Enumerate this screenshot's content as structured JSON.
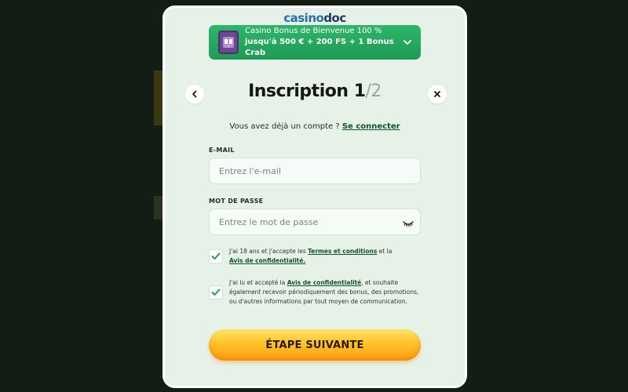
{
  "header": {
    "logo_main": "casino",
    "logo_accent": "doc"
  },
  "bonus": {
    "line1": "Casino Bonus de Bienvenue 100 %",
    "line2": "jusqu'à 500 € + 200 FS + 1 Bonus Crab",
    "icon": "chevron-down-icon"
  },
  "title": {
    "label": "Inscription",
    "step": "1",
    "total": "/2"
  },
  "login": {
    "prompt": "Vous avez déjà un compte ?",
    "link": "Se connecter"
  },
  "form": {
    "email_label": "E-MAIL",
    "email_placeholder": "Entrez l'e-mail",
    "password_label": "MOT DE PASSE",
    "password_placeholder": "Entrez le mot de passe",
    "password_toggle_icon": "eye-closed-icon"
  },
  "consents": [
    {
      "checked": true,
      "t1": "J'ai 18 ans et j'accepte les ",
      "l1": "Termes et conditions",
      "t2": " et la ",
      "l2": "Avis de confidentialité.",
      "t3": ""
    },
    {
      "checked": true,
      "t1": "J'ai lu et accepté la ",
      "l1": "Avis de confidentialité",
      "t2": ", et souhaite également recevoir périodiquement des bonus, des promotions, ou d'autres informations par tout moyen de communication.",
      "l2": "",
      "t3": ""
    }
  ],
  "actions": {
    "next_label": "ÉTAPE SUIVANTE"
  },
  "colors": {
    "modal_bg": "#e6f1e7",
    "banner_green": "#1f9a55",
    "link_green": "#12522c",
    "cta_orange": "#ffb020"
  }
}
